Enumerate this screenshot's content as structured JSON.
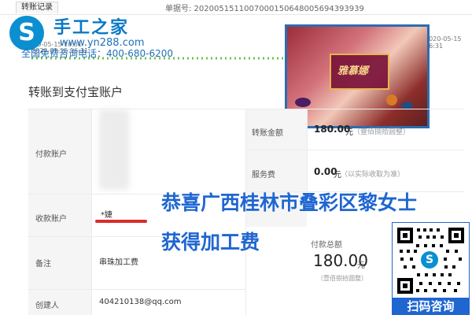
{
  "header": {
    "tab_record": "转账记录",
    "order_no": "单据号: 2020051511007000150648005694393939",
    "timestamp_left": "2020-05-15 16:31",
    "timestamp_small": "2020-05-15 16:31",
    "timestamp_right": "2020-05-15 16:31"
  },
  "logo": {
    "mark": "S",
    "title": "手工之家",
    "url": "www.yn288.com",
    "hotline": "全国免费咨询电话：400-680-6200"
  },
  "product": {
    "brand": "雅慕娜"
  },
  "transfer": {
    "section_title": "转账到支付宝账户",
    "left_labels": {
      "payment_account": "付款账户",
      "receiving_account": "收款账户",
      "note": "备注",
      "creator": "创建人"
    },
    "left_values": {
      "receiving_account": "*婕",
      "note": "串珠加工费",
      "creator": "404210138@qq.com"
    },
    "right_labels": {
      "transfer_amount": "转账金额",
      "service_fee": "服务费"
    },
    "right_values": {
      "transfer_amount": "180.00",
      "transfer_unit": "元",
      "transfer_note": "（壹佰捌拾圆整）",
      "service_fee": "0.00",
      "service_unit": "元",
      "service_note": "（以实际收取为准）"
    },
    "total": {
      "label": "付款总额",
      "value": "180.00",
      "unit": "元",
      "note": "（壹佰捌拾圆整）"
    }
  },
  "overlay": {
    "line1": "恭喜广西桂林市叠彩区黎女士",
    "line2": "获得加工费"
  },
  "qr": {
    "center_mark": "S",
    "banner": "扫码咨询"
  },
  "colors": {
    "primary_blue": "#1f66d1",
    "logo_blue": "#0b8fd0",
    "progress_green": "#6ec04a"
  }
}
